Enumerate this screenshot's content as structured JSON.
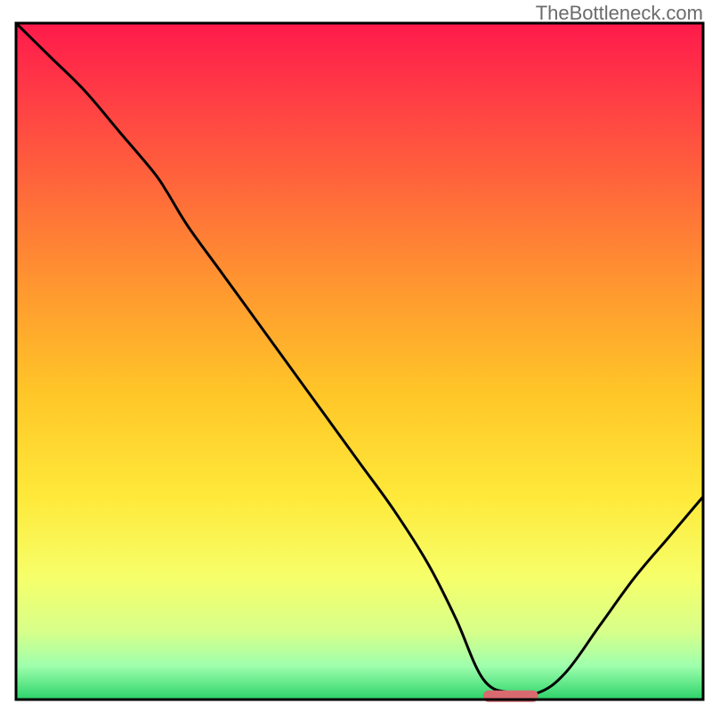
{
  "watermark": "TheBottleneck.com",
  "chart_data": {
    "type": "line",
    "title": "",
    "xlabel": "",
    "ylabel": "",
    "xlim": [
      0,
      100
    ],
    "ylim": [
      0,
      100
    ],
    "grid": false,
    "legend": false,
    "description": "Bottleneck percentage curve over a rainbow gradient background (red=high bottleneck at top, green=low at bottom). The black curve starts near 100% at x≈0, descends roughly linearly with a slight inflection near x≈22, reaches a flat minimum near 0% around x≈68–76, then rises again toward ~30% at x=100. A short red rounded marker highlights the optimum region on the x-axis.",
    "series": [
      {
        "name": "bottleneck_curve",
        "x": [
          0,
          5,
          10,
          15,
          20,
          22,
          25,
          30,
          35,
          40,
          45,
          50,
          55,
          60,
          64,
          68,
          72,
          76,
          80,
          85,
          90,
          95,
          100
        ],
        "y": [
          100,
          95,
          90,
          84,
          78,
          75,
          70,
          63,
          56,
          49,
          42,
          35,
          28,
          20,
          12,
          3,
          1,
          1,
          4,
          11,
          18,
          24,
          30
        ]
      }
    ],
    "optimum_marker": {
      "x_start": 68,
      "x_end": 76,
      "y": 0.5,
      "color": "#d96a6f"
    },
    "gradient_stops": [
      {
        "offset": 0.0,
        "color": "#ff1a4b"
      },
      {
        "offset": 0.1,
        "color": "#ff3a46"
      },
      {
        "offset": 0.25,
        "color": "#ff6a3a"
      },
      {
        "offset": 0.4,
        "color": "#ff9a2f"
      },
      {
        "offset": 0.55,
        "color": "#ffc728"
      },
      {
        "offset": 0.7,
        "color": "#ffe93a"
      },
      {
        "offset": 0.82,
        "color": "#f6ff6a"
      },
      {
        "offset": 0.9,
        "color": "#d7ff8a"
      },
      {
        "offset": 0.95,
        "color": "#9fffad"
      },
      {
        "offset": 1.0,
        "color": "#2bd36a"
      }
    ],
    "frame": {
      "stroke": "#000000",
      "stroke_width": 3
    },
    "curve_style": {
      "stroke": "#000000",
      "stroke_width": 3
    }
  }
}
